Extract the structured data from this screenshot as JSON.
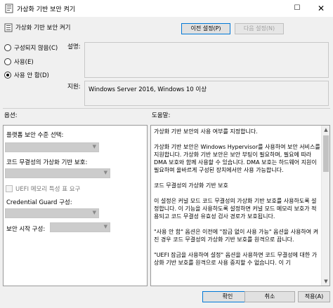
{
  "window": {
    "title": "가상화 기반 보안 켜기",
    "maximize_glyph": "☐",
    "close_glyph": "✕"
  },
  "header": {
    "title": "가상화 기반 보안 켜기",
    "prev_setting_label": "이전 설정(P)",
    "next_setting_label": "다음 설정(N)"
  },
  "state": {
    "options": [
      {
        "label": "구성되지 않음(C)",
        "selected": false
      },
      {
        "label": "사용(E)",
        "selected": false
      },
      {
        "label": "사용 안 함(D)",
        "selected": true
      }
    ]
  },
  "comment": {
    "label": "설명:",
    "value": ""
  },
  "supported": {
    "label": "지원:",
    "value": "Windows Server 2016, Windows 10 이상"
  },
  "options_panel": {
    "heading": "옵션:",
    "platform_security_label": "플랫폼 보안 수준 선택:",
    "code_integrity_label": "코드 무결성의 가상화 기반 보호:",
    "uefi_memory_label": "UEFI 메모리 특성 표 요구",
    "credential_guard_label": "Credential Guard 구성:",
    "secure_launch_label": "보안 시작 구성:"
  },
  "help_panel": {
    "heading": "도움말:",
    "paragraphs": [
      "가상화 기반 보안의 사용 여부를 지정합니다.",
      "가상화 기반 보안은 Windows Hypervisor를 사용하여 보안 서비스를 지원합니다. 가상화 기반 보안은 보안 부팅이 필요하며, 필요에 따라 DMA 보호와 함께 사용할 수 있습니다. DMA 보호는 하드웨어 지원이 필요하며 올바르게 구성된 장치에서만 사용 가능합니다.",
      "코드 무결성의 가상화 기반 보호",
      "이 설정은 커널 모드 코드 무결성의 가상화 기반 보호를 사용하도록 설정합니다. 이 기능을 사용하도록 설정하면 커널 모드 메모리 보호가 적용되고 코드 무결성 유효성 검사 경로가 보호됩니다.",
      "\"사용 안 함\" 옵션은 이전에 \"잠금 없이 사용 가능\" 옵션을 사용하여 켜진 경우 코드 무결성의 가상화 기반 보호를 원격으로 끕니다.",
      "\"UEFI 잠금을 사용하여 설정\" 옵션을 사용하면 코드 무결성에 대한 가상화 기반 보호를 원격으로 사용 중지할 수 없습니다. 이 기"
    ]
  },
  "footer": {
    "ok_label": "확인",
    "cancel_label": "취소",
    "apply_label": "적용(A)"
  },
  "icons": {
    "app": "policy-icon",
    "scroll_up": "▲",
    "scroll_down": "▼",
    "dropdown": "▼"
  },
  "colors": {
    "accent": "#0078d7",
    "dialog_bg": "#f0f0f0"
  }
}
